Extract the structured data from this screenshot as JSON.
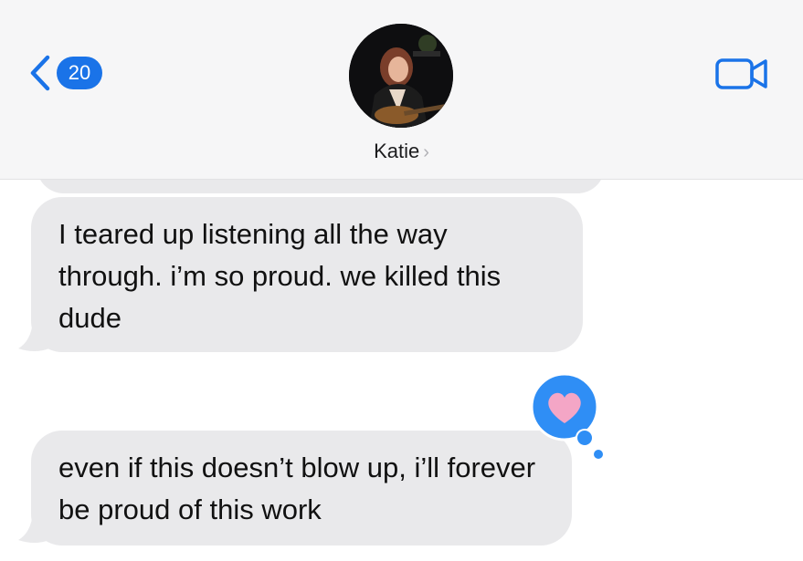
{
  "header": {
    "back_label": "back",
    "unread_count": "20",
    "contact_name": "Katie",
    "contact_chevron": "›",
    "video_icon": "video-camera-icon"
  },
  "messages": [
    {
      "direction": "incoming",
      "text": "I teared up listening all the way through. i’m so proud. we killed this dude"
    },
    {
      "direction": "incoming",
      "text": "even if this doesn’t blow up, i’ll forever be proud of this work",
      "reaction": "heart"
    }
  ],
  "colors": {
    "accent": "#1a73e8",
    "incoming_bubble": "#e9e9eb",
    "header_bg": "#f6f6f7",
    "reaction_bubble": "#2f8ef5",
    "heart": "#f4a6c6"
  }
}
